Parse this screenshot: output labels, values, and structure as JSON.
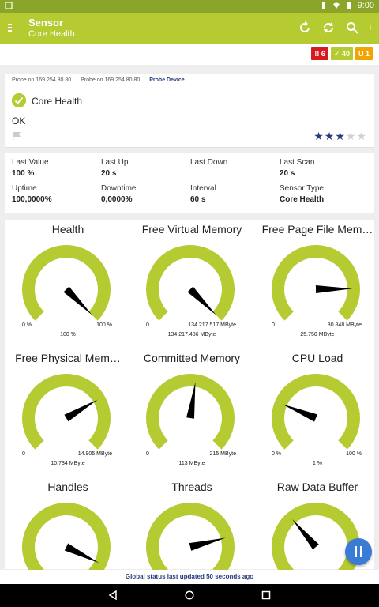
{
  "statusbar": {
    "time": "9:00"
  },
  "appbar": {
    "title": "Sensor",
    "subtitle": "Core Health"
  },
  "badges": [
    {
      "text": "!! 6",
      "color": "#d71920"
    },
    {
      "text": "✓ 40",
      "color": "#b5cb31"
    },
    {
      "text": "U 1",
      "color": "#f2a500"
    }
  ],
  "breadcrumb": [
    "Probe on 169.254.80.80",
    "Probe on 169.254.80.80",
    "Probe Device"
  ],
  "sensor": {
    "name": "Core Health",
    "status": "OK",
    "priority": 3,
    "priority_max": 5
  },
  "stats": [
    {
      "label": "Last Value",
      "value": "100 %"
    },
    {
      "label": "Last Up",
      "value": "20 s"
    },
    {
      "label": "Last Down",
      "value": ""
    },
    {
      "label": "Last Scan",
      "value": "20 s"
    },
    {
      "label": "Uptime",
      "value": "100,0000%"
    },
    {
      "label": "Downtime",
      "value": "0,0000%"
    },
    {
      "label": "Interval",
      "value": "60 s"
    },
    {
      "label": "Sensor Type",
      "value": "Core Health"
    }
  ],
  "gauges": [
    {
      "title": "Health",
      "min": "0 %",
      "max": "100 %",
      "value": "100 %",
      "fraction": 1.0
    },
    {
      "title": "Free Virtual Memory",
      "min": "0",
      "max": "134.217.517 MByte",
      "value": "134.217.486 MByte",
      "fraction": 1.0
    },
    {
      "title": "Free Page File Mem…",
      "min": "0",
      "max": "30.848 MByte",
      "value": "25.750 MByte",
      "fraction": 0.83
    },
    {
      "title": "Free Physical Mem…",
      "min": "0",
      "max": "14.905 MByte",
      "value": "10.734 MByte",
      "fraction": 0.72
    },
    {
      "title": "Committed Memory",
      "min": "0",
      "max": "215 MByte",
      "value": "113 MByte",
      "fraction": 0.53
    },
    {
      "title": "CPU Load",
      "min": "0 %",
      "max": "100 %",
      "value": "1 %",
      "fraction": 0.25
    },
    {
      "title": "Handles",
      "min": "",
      "max": "",
      "value": "",
      "fraction": 0.93
    },
    {
      "title": "Threads",
      "min": "",
      "max": "",
      "value": "",
      "fraction": 0.78
    },
    {
      "title": "Raw Data Buffer",
      "min": "",
      "max": "",
      "value": "",
      "fraction": 0.35
    }
  ],
  "footer": {
    "global_status": "Global status last updated 50 seconds ago"
  },
  "colors": {
    "appbar": "#b5cb31",
    "statusbar": "#8aa52a",
    "gauge_arc": "#b5cb31",
    "accent_blue": "#2a3b7c",
    "fab": "#3a7bd5"
  }
}
